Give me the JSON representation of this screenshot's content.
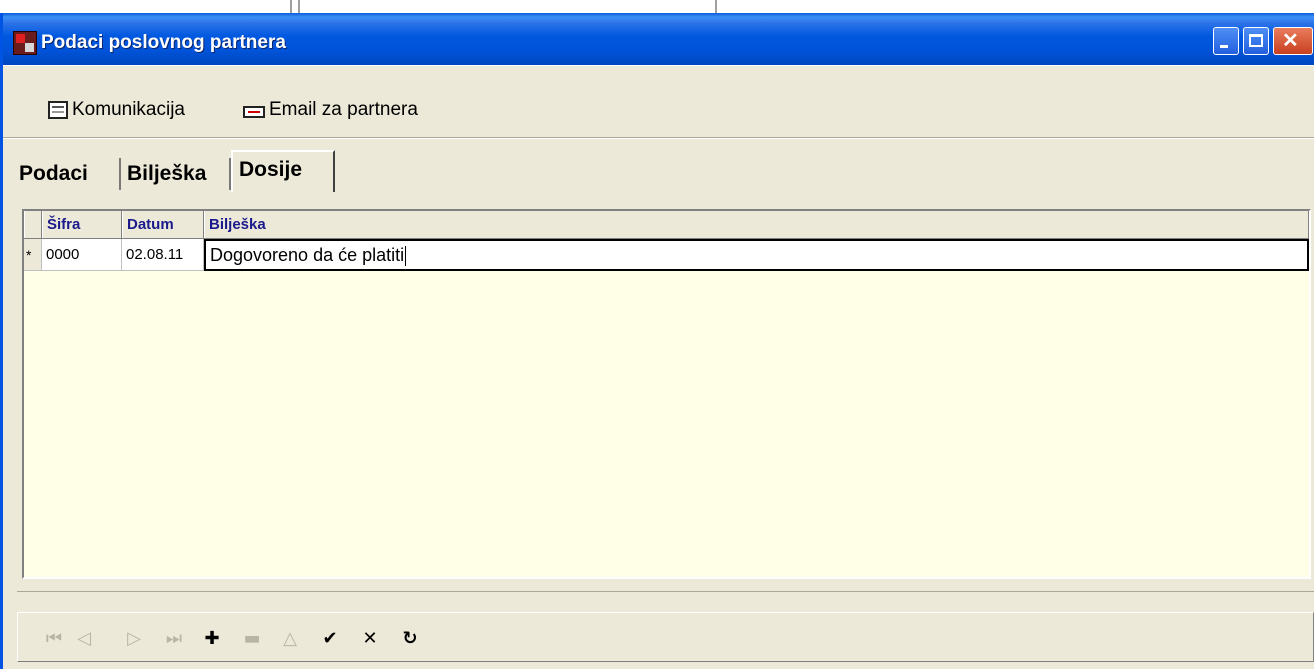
{
  "window": {
    "title": "Podaci poslovnog partnera"
  },
  "toolbar": {
    "komunikacija_label": "Komunikacija",
    "email_label": "Email za partnera"
  },
  "tabs": [
    {
      "label": "Podaci",
      "active": false
    },
    {
      "label": "Bilješka",
      "active": false
    },
    {
      "label": "Dosije",
      "active": true
    }
  ],
  "grid": {
    "columns": [
      "Šifra",
      "Datum",
      "Bilješka"
    ],
    "rows": [
      {
        "indicator": "*",
        "sifra": "0000",
        "datum": "02.08.11",
        "biljeska": "Dogovoreno da će platiti"
      }
    ]
  },
  "navigator": {
    "first": "⏮",
    "prior": "◁",
    "next": "▷",
    "last": "⏭",
    "insert": "✚",
    "delete": "▬",
    "edit": "△",
    "post": "✔",
    "cancel": "✕",
    "refresh": "↻"
  },
  "colors": {
    "titlebar": "#0058e0",
    "grid_bg": "#ffffe8",
    "header_text": "#1a1a8c"
  }
}
